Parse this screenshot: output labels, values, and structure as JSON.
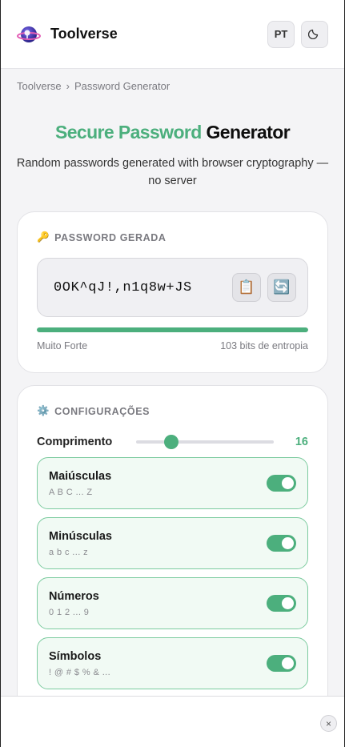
{
  "header": {
    "brand": "Toolverse",
    "lang_label": "PT"
  },
  "breadcrumb": {
    "home": "Toolverse",
    "separator": "›",
    "current": "Password Generator"
  },
  "hero": {
    "title_green": "Secure Password",
    "title_dark": "Generator",
    "subtitle": "Random passwords generated with browser cryptography — no server"
  },
  "password_card": {
    "label_icon": "🔑",
    "label": "PASSWORD GERADA",
    "password": "0OK^qJ!,n1q8w+JS",
    "copy_icon": "📋",
    "refresh_icon": "🔄",
    "strength_fraction": 1.0,
    "strength_label": "Muito Forte",
    "entropy_label": "103 bits de entropia"
  },
  "settings_card": {
    "label_icon": "⚙️",
    "label": "CONFIGURAÇÕES",
    "length_label": "Comprimento",
    "length_value": "16",
    "length_min": 4,
    "length_max": 64,
    "length_fraction": 0.23,
    "options": [
      {
        "title": "Maiúsculas",
        "sub": "A B C ... Z",
        "enabled": true
      },
      {
        "title": "Minúsculas",
        "sub": "a b c ... z",
        "enabled": true
      },
      {
        "title": "Números",
        "sub": "0 1 2 ... 9",
        "enabled": true
      },
      {
        "title": "Símbolos",
        "sub": "! @ # $ % & ...",
        "enabled": true
      }
    ]
  },
  "footer": {
    "close_label": "×"
  },
  "colors": {
    "accent": "#4caf7d",
    "background": "#f4f4f6"
  }
}
